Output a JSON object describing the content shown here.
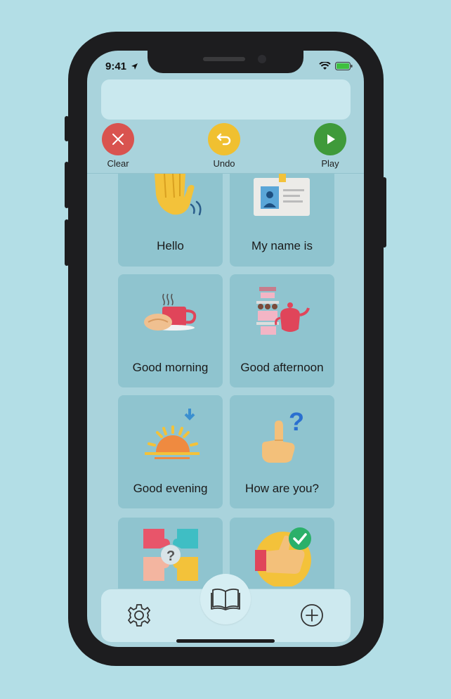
{
  "status_bar": {
    "time": "9:41"
  },
  "actions": {
    "clear_label": "Clear",
    "undo_label": "Undo",
    "play_label": "Play"
  },
  "tiles": [
    {
      "label": "Hello",
      "icon": "waving-hand-icon"
    },
    {
      "label": "My name is",
      "icon": "id-card-icon"
    },
    {
      "label": "Good morning",
      "icon": "coffee-breakfast-icon"
    },
    {
      "label": "Good afternoon",
      "icon": "afternoon-tea-icon"
    },
    {
      "label": "Good evening",
      "icon": "sunset-icon"
    },
    {
      "label": "How are you?",
      "icon": "pointing-question-icon"
    },
    {
      "label": "",
      "icon": "puzzle-question-icon"
    },
    {
      "label": "",
      "icon": "thumbs-up-check-icon"
    }
  ],
  "bottom_nav": {
    "settings_icon": "gear-icon",
    "library_icon": "book-icon",
    "add_icon": "plus-circle-icon"
  },
  "colors": {
    "background": "#b3dee6",
    "clear": "#d9534f",
    "undo": "#f0c030",
    "play": "#3f9a3a",
    "tile": "#8fc4cf"
  }
}
